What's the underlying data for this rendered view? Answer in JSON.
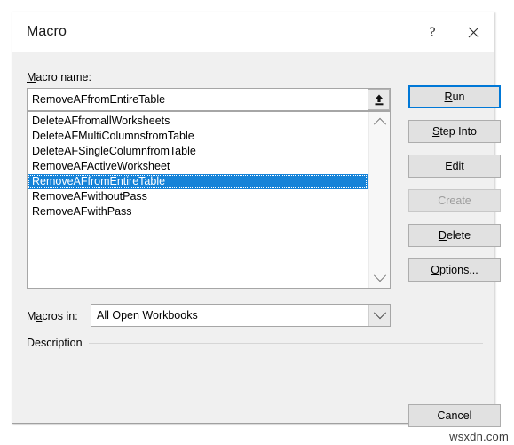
{
  "dialog": {
    "title": "Macro",
    "titlebar_buttons": [
      {
        "name": "help-button",
        "glyph": "?"
      },
      {
        "name": "close-button",
        "glyph": "✕"
      }
    ]
  },
  "macro_name": {
    "label_prefix": "M",
    "label_rest": "acro name:",
    "value": "RemoveAFfromEntireTable",
    "placeholder": "",
    "upload_button_icon": "upload-arrow-icon"
  },
  "macro_list": {
    "items": [
      {
        "label": "DeleteAFfromallWorksheets",
        "selected": false
      },
      {
        "label": "DeleteAFMultiColumnsfromTable",
        "selected": false
      },
      {
        "label": "DeleteAFSingleColumnfromTable",
        "selected": false
      },
      {
        "label": "RemoveAFActiveWorksheet",
        "selected": false
      },
      {
        "label": "RemoveAFfromEntireTable",
        "selected": true
      },
      {
        "label": "RemoveAFwithoutPass",
        "selected": false
      },
      {
        "label": "RemoveAFwithPass",
        "selected": false
      }
    ],
    "selected_index": 4,
    "selection_color": "#1683d8",
    "scrollbar": {
      "up_arrow_icon": "chevron-up-icon",
      "down_arrow_icon": "chevron-down-icon"
    }
  },
  "macros_in": {
    "label_prefix": "M",
    "label_accel": "a",
    "label_rest": "cros in:",
    "value": "All Open Workbooks",
    "arrow_icon": "chevron-down-icon"
  },
  "description": {
    "label": "Description"
  },
  "buttons": {
    "run": {
      "accel": "R",
      "rest": "un",
      "state": "default"
    },
    "step_into": {
      "accel": "S",
      "rest": "tep Into",
      "state": "enabled"
    },
    "edit": {
      "accel": "E",
      "rest": "dit",
      "state": "enabled"
    },
    "create": {
      "accel": "",
      "rest": "Create",
      "state": "disabled"
    },
    "delete": {
      "accel": "D",
      "rest": "elete",
      "state": "enabled"
    },
    "options": {
      "accel": "O",
      "rest": "ptions...",
      "state": "enabled"
    },
    "cancel": {
      "accel": "",
      "rest": "Cancel",
      "state": "enabled"
    }
  },
  "watermark": {
    "text": "wsxdn.com"
  },
  "colors": {
    "accent": "#0078d7",
    "selection": "#1683d8",
    "dialog_bg": "#f0f0f0",
    "titlebar_bg": "#ffffff",
    "button_bg": "#e1e1e1"
  }
}
